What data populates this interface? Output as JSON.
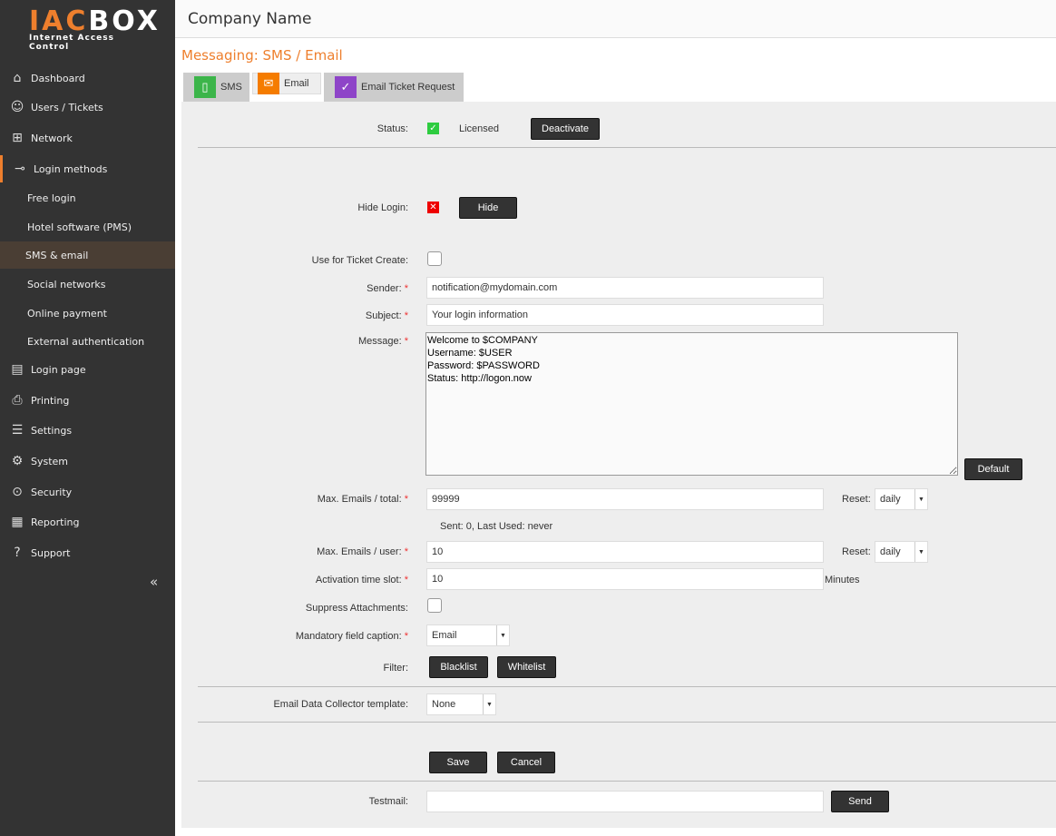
{
  "app": {
    "logo_orange": "IAC",
    "logo_white": "BOX",
    "logo_sub": "Internet Access Control",
    "company": "Company Name"
  },
  "sidebar": {
    "items": [
      {
        "label": "Dashboard",
        "icon": "home-icon"
      },
      {
        "label": "Users / Tickets",
        "icon": "users-icon"
      },
      {
        "label": "Network",
        "icon": "network-icon"
      },
      {
        "label": "Login methods",
        "icon": "key-icon"
      },
      {
        "label": "Free login"
      },
      {
        "label": "Hotel software (PMS)"
      },
      {
        "label": "SMS & email"
      },
      {
        "label": "Social networks"
      },
      {
        "label": "Online payment"
      },
      {
        "label": "External authentication"
      },
      {
        "label": "Login page",
        "icon": "monitor-icon"
      },
      {
        "label": "Printing",
        "icon": "printer-icon"
      },
      {
        "label": "Settings",
        "icon": "sliders-icon"
      },
      {
        "label": "System",
        "icon": "gear-icon"
      },
      {
        "label": "Security",
        "icon": "lock-icon"
      },
      {
        "label": "Reporting",
        "icon": "report-icon"
      },
      {
        "label": "Support",
        "icon": "question-icon"
      }
    ],
    "collapse": "«"
  },
  "page": {
    "title": "Messaging: SMS / Email"
  },
  "tabs": [
    {
      "label": "SMS",
      "color": "#3cb54a"
    },
    {
      "label": "Email",
      "color": "#f57c00"
    },
    {
      "label": "Email Ticket Request",
      "color": "#8e44c8"
    }
  ],
  "form": {
    "status_label": "Status:",
    "status_value": "Licensed",
    "deactivate": "Deactivate",
    "hide_label": "Hide Login:",
    "hide_btn": "Hide",
    "ticket_label": "Use for Ticket Create:",
    "sender_label": "Sender:",
    "sender": "notification@mydomain.com",
    "subject_label": "Subject:",
    "subject": "Your login information",
    "message_label": "Message:",
    "message": "Welcome to $COMPANY\nUsername: $USER\nPassword: $PASSWORD\nStatus: http://logon.now",
    "default_btn": "Default",
    "max_total_label": "Max. Emails / total:",
    "max_total": "99999",
    "reset_label": "Reset:",
    "reset_total": "daily",
    "sent_info": "Sent: 0, Last Used: never",
    "max_user_label": "Max. Emails / user:",
    "max_user": "10",
    "reset_user": "daily",
    "slot_label": "Activation time slot:",
    "slot": "10",
    "slot_unit": "Minutes",
    "suppress_label": "Suppress Attachments:",
    "caption_label": "Mandatory field caption:",
    "caption": "Email",
    "filter_label": "Filter:",
    "blacklist": "Blacklist",
    "whitelist": "Whitelist",
    "collector_label": "Email Data Collector template:",
    "collector": "None",
    "save": "Save",
    "cancel": "Cancel",
    "testmail_label": "Testmail:",
    "testmail": "",
    "send": "Send",
    "required": "*"
  }
}
